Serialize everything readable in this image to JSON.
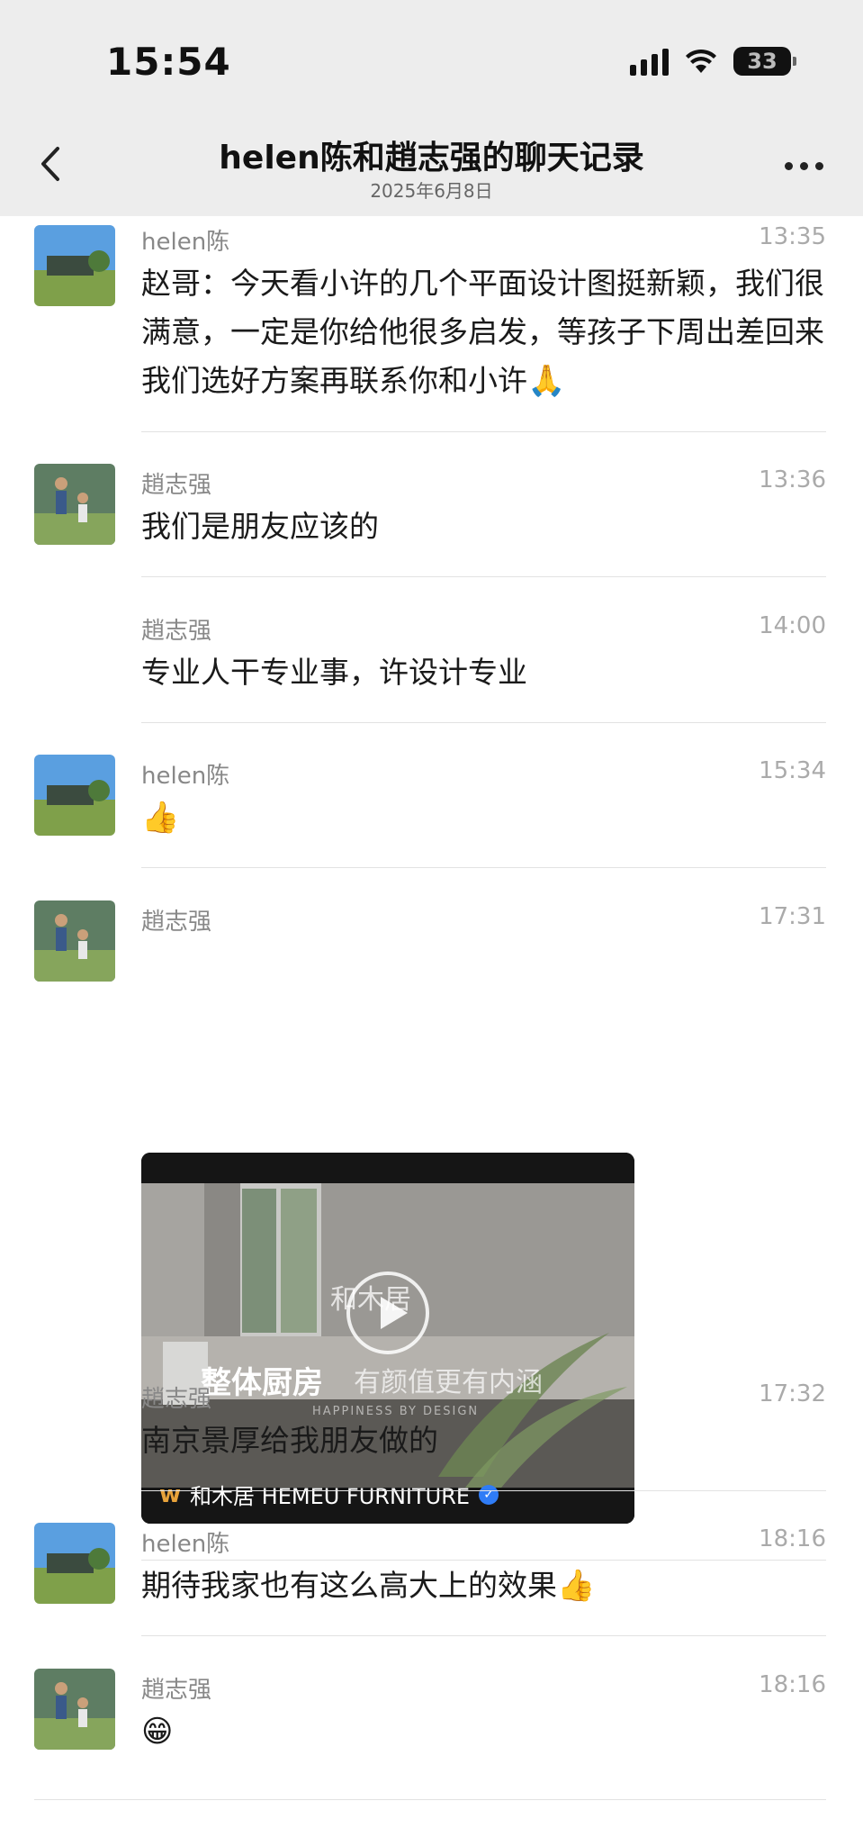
{
  "status_bar": {
    "time": "15:54",
    "battery": "33"
  },
  "header": {
    "title": "helen陈和趙志强的聊天记录",
    "subtitle": "2025年6月8日"
  },
  "messages": [
    {
      "sender": "helen陈",
      "time": "13:35",
      "text": "赵哥：今天看小许的几个平面设计图挺新颖，我们很满意，一定是你给他很多启发，等孩子下周出差回来我们选好方案再联系你和小许",
      "emoji": "🙏"
    },
    {
      "sender": "趙志强",
      "time": "13:36",
      "text": "我们是朋友应该的"
    },
    {
      "sender": "趙志强",
      "time": "14:00",
      "text": "专业人干专业事，许设计专业"
    },
    {
      "sender": "helen陈",
      "time": "15:34",
      "emoji": "👍"
    },
    {
      "sender": "趙志强",
      "time": "17:31",
      "video": {
        "watermark": "和木居",
        "caption_main": "整体厨房",
        "caption_sub": "有颜值更有内涵",
        "tagline": "HAPPINESS BY DESIGN",
        "source": "和木居 HEMEU FURNITURE"
      }
    },
    {
      "sender": "趙志强",
      "time": "17:32",
      "text": "南京景厚给我朋友做的"
    },
    {
      "sender": "helen陈",
      "time": "18:16",
      "text": "期待我家也有这么高大上的效果",
      "emoji": "👍"
    },
    {
      "sender": "趙志强",
      "time": "18:16",
      "emoji": "😁"
    }
  ]
}
